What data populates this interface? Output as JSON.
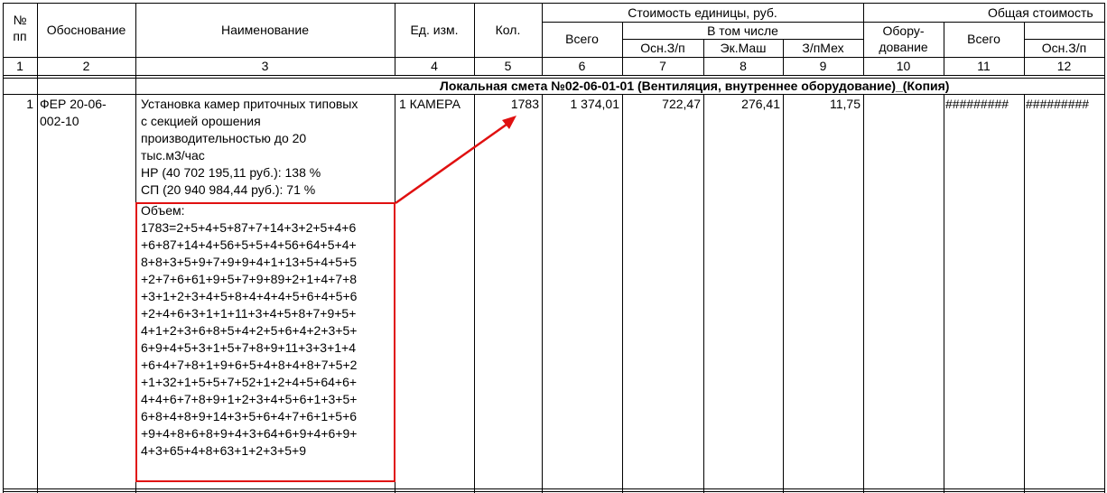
{
  "header": {
    "col_no": "№\nпп",
    "col_no_line1": "№",
    "col_no_line2": "пп",
    "basis": "Обоснование",
    "name": "Наименование",
    "unit": "Ед. изм.",
    "qty": "Кол.",
    "unit_cost_group": "Стоимость единицы, руб.",
    "total_unit": "Всего",
    "incl": "В том числе",
    "osn_zp": "Осн.З/п",
    "ek_mash": "Эк.Маш",
    "zp_mekh": "З/пМех",
    "equip_line1": "Обору-",
    "equip_line2": "дование",
    "total_cost_group": "Общая стоимость",
    "total_all": "Всего",
    "total_osn_zp": "Осн.З/п"
  },
  "col_numbers": [
    "1",
    "2",
    "3",
    "4",
    "5",
    "6",
    "7",
    "8",
    "9",
    "10",
    "11",
    "12"
  ],
  "section_title": "Локальная смета №02-06-01-01 (Вентиляция, внутреннее оборудование)_(Копия)",
  "row": {
    "no": "1",
    "basis_line1": "ФЕР 20-06-",
    "basis_line2": "002-10",
    "name_lines": [
      "Установка камер приточных типовых",
      "с секцией орошения",
      "производительностью до 20",
      "тыс.м3/час",
      "НР (40 702 195,11 руб.): 138 %",
      "СП (20 940 984,44 руб.): 71 %"
    ],
    "volume_label": "Объем:",
    "volume_lines": [
      "1783=2+5+4+5+87+7+14+3+2+5+4+6",
      "+6+87+14+4+56+5+5+4+56+64+5+4+",
      "8+8+3+5+9+7+9+9+4+1+13+5+4+5+5",
      "+2+7+6+61+9+5+7+9+89+2+1+4+7+8",
      "+3+1+2+3+4+5+8+4+4+4+5+6+4+5+6",
      "+2+4+6+3+1+1+11+3+4+5+8+7+9+5+",
      "4+1+2+3+6+8+5+4+2+5+6+4+2+3+5+",
      "6+9+4+5+3+1+5+7+8+9+11+3+3+1+4",
      "+6+4+7+8+1+9+6+5+4+8+4+8+7+5+2",
      "+1+32+1+5+5+7+52+1+2+4+5+64+6+",
      "4+4+6+7+8+9+1+2+3+4+5+6+1+3+5+",
      "6+8+4+8+9+14+3+5+6+4+7+6+1+5+6",
      "+9+4+8+6+8+9+4+3+64+6+9+4+6+9+",
      "4+3+65+4+8+63+1+2+3+5+9"
    ],
    "unit": "1 КАМЕРА",
    "qty": "1783",
    "total_unit": "1 374,01",
    "osn_zp": "722,47",
    "ek_mash": "276,41",
    "zp_mekh": "11,75",
    "equip": "",
    "total_all": "#########",
    "total_osn_zp": "#########"
  },
  "colors": {
    "highlight": "#e01010",
    "grid": "#000000"
  }
}
